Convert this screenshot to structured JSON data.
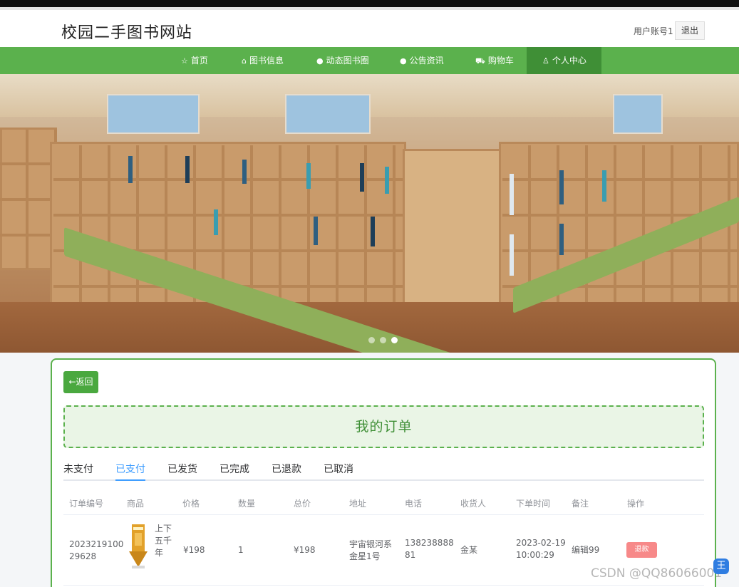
{
  "header": {
    "site_title": "校园二手图书网站",
    "user_label": "用户账号1",
    "logout_label": "退出"
  },
  "nav": {
    "items": [
      {
        "label": "首页",
        "icon": "star-icon"
      },
      {
        "label": "图书信息",
        "icon": "bag-icon"
      },
      {
        "label": "动态图书圈",
        "icon": "circle-icon"
      },
      {
        "label": "公告资讯",
        "icon": "circle-icon"
      },
      {
        "label": "购物车",
        "icon": "cart-icon"
      },
      {
        "label": "个人中心",
        "icon": "user-icon"
      }
    ],
    "active_index": 5,
    "bar_color": "#5bb14d",
    "active_color": "#3f8f36"
  },
  "carousel": {
    "slide_count": 3,
    "active_slide": 3
  },
  "panel": {
    "back_label": "←返回",
    "title": "我的订单",
    "tabs": [
      "未支付",
      "已支付",
      "已发货",
      "已完成",
      "已退款",
      "已取消"
    ],
    "active_tab": 1
  },
  "table": {
    "headers": [
      "订单编号",
      "商品",
      "价格",
      "数量",
      "总价",
      "地址",
      "电话",
      "收货人",
      "下单时间",
      "备注",
      "操作"
    ],
    "rows": [
      {
        "order_no_line1": "2023219100",
        "order_no_line2": "29628",
        "product_line1": "上下",
        "product_line2": "五千",
        "product_line3": "年",
        "price": "¥198",
        "quantity": "1",
        "total": "¥198",
        "address_line1": "宇宙银河系",
        "address_line2": "金星1号",
        "phone_line1": "138238888",
        "phone_line2": "81",
        "receiver": "金某",
        "order_time_line1": "2023-02-19",
        "order_time_line2": "10:00:29",
        "remark": "编辑99",
        "action_label": "退款"
      }
    ]
  },
  "watermark": "CSDN @QQ86066001",
  "corner_badge": "王"
}
